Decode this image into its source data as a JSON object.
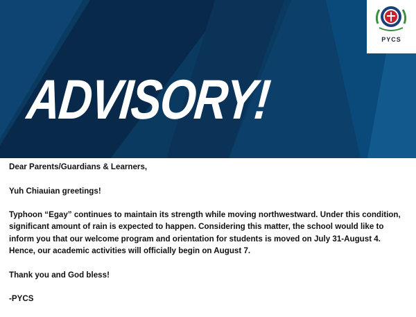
{
  "banner": {
    "headline": "ADVISORY!",
    "colors": {
      "base": "#0b3a60",
      "stripe_dark": "#08294a",
      "stripe_light": "#12598e"
    }
  },
  "logo": {
    "icon": "school-seal-icon",
    "caption": "PYCS"
  },
  "letter": {
    "salutation": "Dear Parents/Guardians & Learners,",
    "greeting": "Yuh Chiauian greetings!",
    "body_lines": [
      "Typhoon “Egay” continues to maintain its strength while moving northwestward. Under this condition,",
      "significant amount of rain is expected to happen. Considering this matter, the school would like to",
      "inform you that our welcome program and orientation for students is moved on July 31-August 4.",
      "Hence, our academic activities will officially begin on August 7."
    ],
    "closing": "Thank you and God bless!",
    "signature": "-PYCS"
  }
}
